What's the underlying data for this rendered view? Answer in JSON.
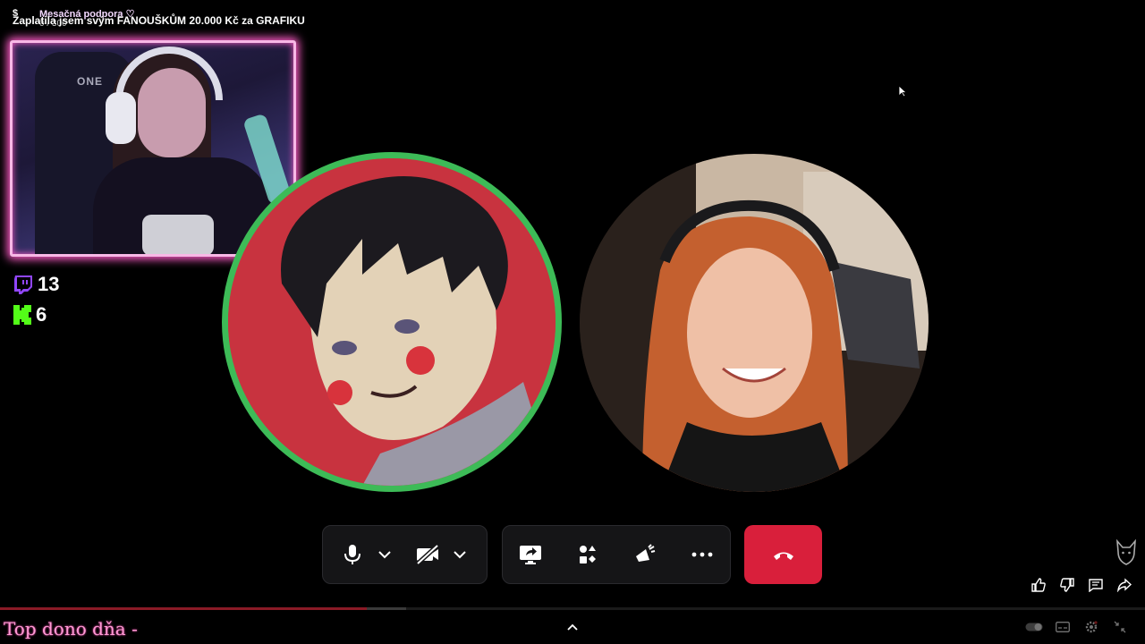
{
  "overlay": {
    "currency_glyph": "$",
    "sub_goal_label": "Mesačná podpora ♡",
    "sub_goal_count": "0 / 300",
    "title": "Zaplatila jsem svým FANOUŠKŮM 20.000 Kč za GRAFIKU"
  },
  "counters": {
    "twitch_viewers": "13",
    "kick_viewers": "6",
    "twitch_color": "#9146ff",
    "kick_color": "#53fc18"
  },
  "call": {
    "speaking_ring_color": "#3dbb57",
    "end_call_color": "#d91f3b",
    "controls": [
      {
        "icon": "microphone-icon"
      },
      {
        "icon": "chevron-down-icon"
      },
      {
        "icon": "camera-off-icon"
      },
      {
        "icon": "chevron-down-icon"
      },
      {
        "icon": "screen-share-icon"
      },
      {
        "icon": "activities-icon"
      },
      {
        "icon": "soundboard-icon"
      },
      {
        "icon": "more-icon"
      },
      {
        "icon": "hang-up-icon"
      }
    ]
  },
  "player": {
    "progress_fraction": 0.32,
    "buffer_fraction": 0.035,
    "ticker_text": "Top dono dňa -",
    "accent_color": "#ff9ad5"
  }
}
